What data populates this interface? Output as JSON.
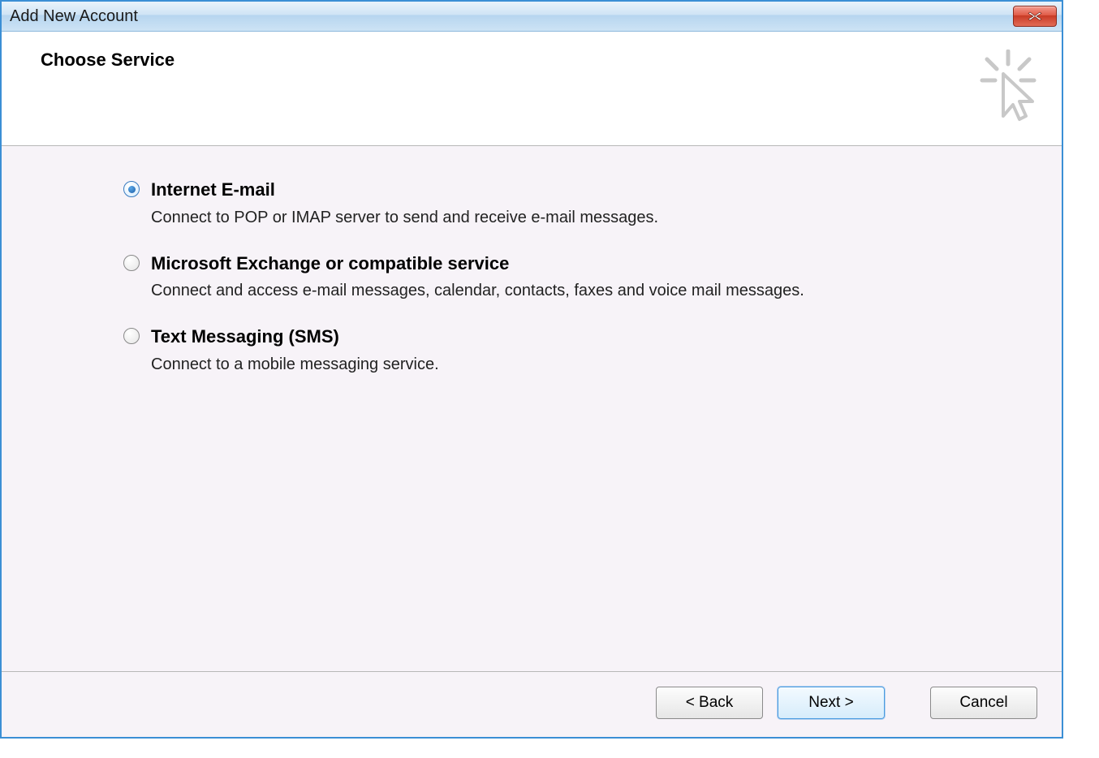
{
  "window": {
    "title": "Add New Account"
  },
  "header": {
    "title": "Choose Service"
  },
  "options": [
    {
      "title": "Internet E-mail",
      "description": "Connect to POP or IMAP server to send and receive e-mail messages.",
      "selected": true
    },
    {
      "title": "Microsoft Exchange or compatible service",
      "description": "Connect and access e-mail messages, calendar, contacts, faxes and voice mail messages.",
      "selected": false
    },
    {
      "title": "Text Messaging (SMS)",
      "description": "Connect to a mobile messaging service.",
      "selected": false
    }
  ],
  "footer": {
    "back": "< Back",
    "next": "Next >",
    "cancel": "Cancel"
  }
}
